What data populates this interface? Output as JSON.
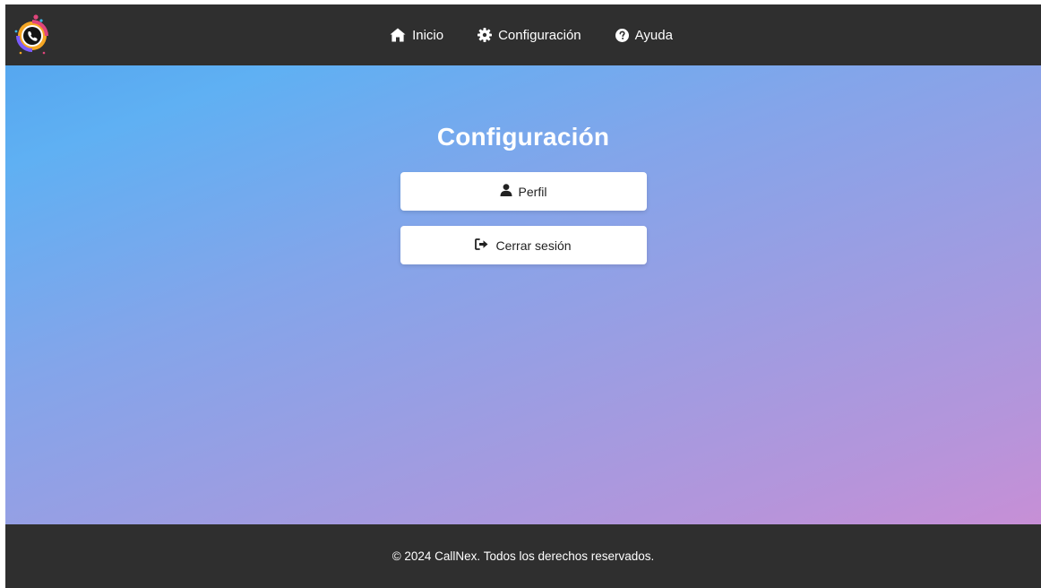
{
  "brand": {
    "logo_icon": "callnex-logo-icon"
  },
  "nav": {
    "items": [
      {
        "label": "Inicio",
        "icon": "home-icon"
      },
      {
        "label": "Configuración",
        "icon": "gear-icon"
      },
      {
        "label": "Ayuda",
        "icon": "help-icon"
      }
    ]
  },
  "main": {
    "title": "Configuración",
    "buttons": [
      {
        "label": "Perfil",
        "icon": "user-icon"
      },
      {
        "label": "Cerrar sesión",
        "icon": "sign-out-icon"
      }
    ]
  },
  "footer": {
    "text": "© 2024 CallNex. Todos los derechos reservados."
  },
  "colors": {
    "header_bg": "#2f2f2f",
    "footer_bg": "#2f2f2f",
    "gradient_start": "#5fb0f3",
    "gradient_end": "#c78fd6",
    "button_bg": "#ffffff",
    "title_text": "#ffffff"
  }
}
